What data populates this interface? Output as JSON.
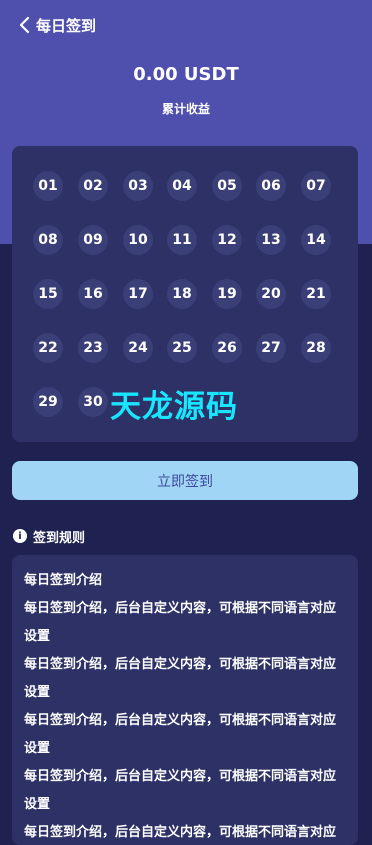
{
  "header": {
    "title": "每日签到",
    "back_icon": "chevron-left-icon"
  },
  "summary": {
    "amount": "0.00 USDT",
    "label": "累计收益"
  },
  "calendar": {
    "days": [
      "01",
      "02",
      "03",
      "04",
      "05",
      "06",
      "07",
      "08",
      "09",
      "10",
      "11",
      "12",
      "13",
      "14",
      "15",
      "16",
      "17",
      "18",
      "19",
      "20",
      "21",
      "22",
      "23",
      "24",
      "25",
      "26",
      "27",
      "28",
      "29",
      "30"
    ]
  },
  "watermark": "天龙源码",
  "actions": {
    "signin_label": "立即签到"
  },
  "rules": {
    "icon": "info-icon",
    "icon_glyph": "i",
    "title": "签到规则",
    "lines": [
      "每日签到介绍",
      "每日签到介绍，后台自定义内容，可根据不同语言对应设置",
      "每日签到介绍，后台自定义内容，可根据不同语言对应设置",
      "每日签到介绍，后台自定义内容，可根据不同语言对应设置",
      "每日签到介绍，后台自定义内容，可根据不同语言对应设置",
      "每日签到介绍，后台自定义内容，可根据不同语言对应设置"
    ]
  },
  "colors": {
    "header_bg": "#4f4fae",
    "page_bg": "#1f2150",
    "card_bg": "#2d3166",
    "day_bg": "#3b3f78",
    "button_bg": "#a0d5f5",
    "button_text": "#3d4a9a",
    "watermark": "#18e6ff"
  }
}
